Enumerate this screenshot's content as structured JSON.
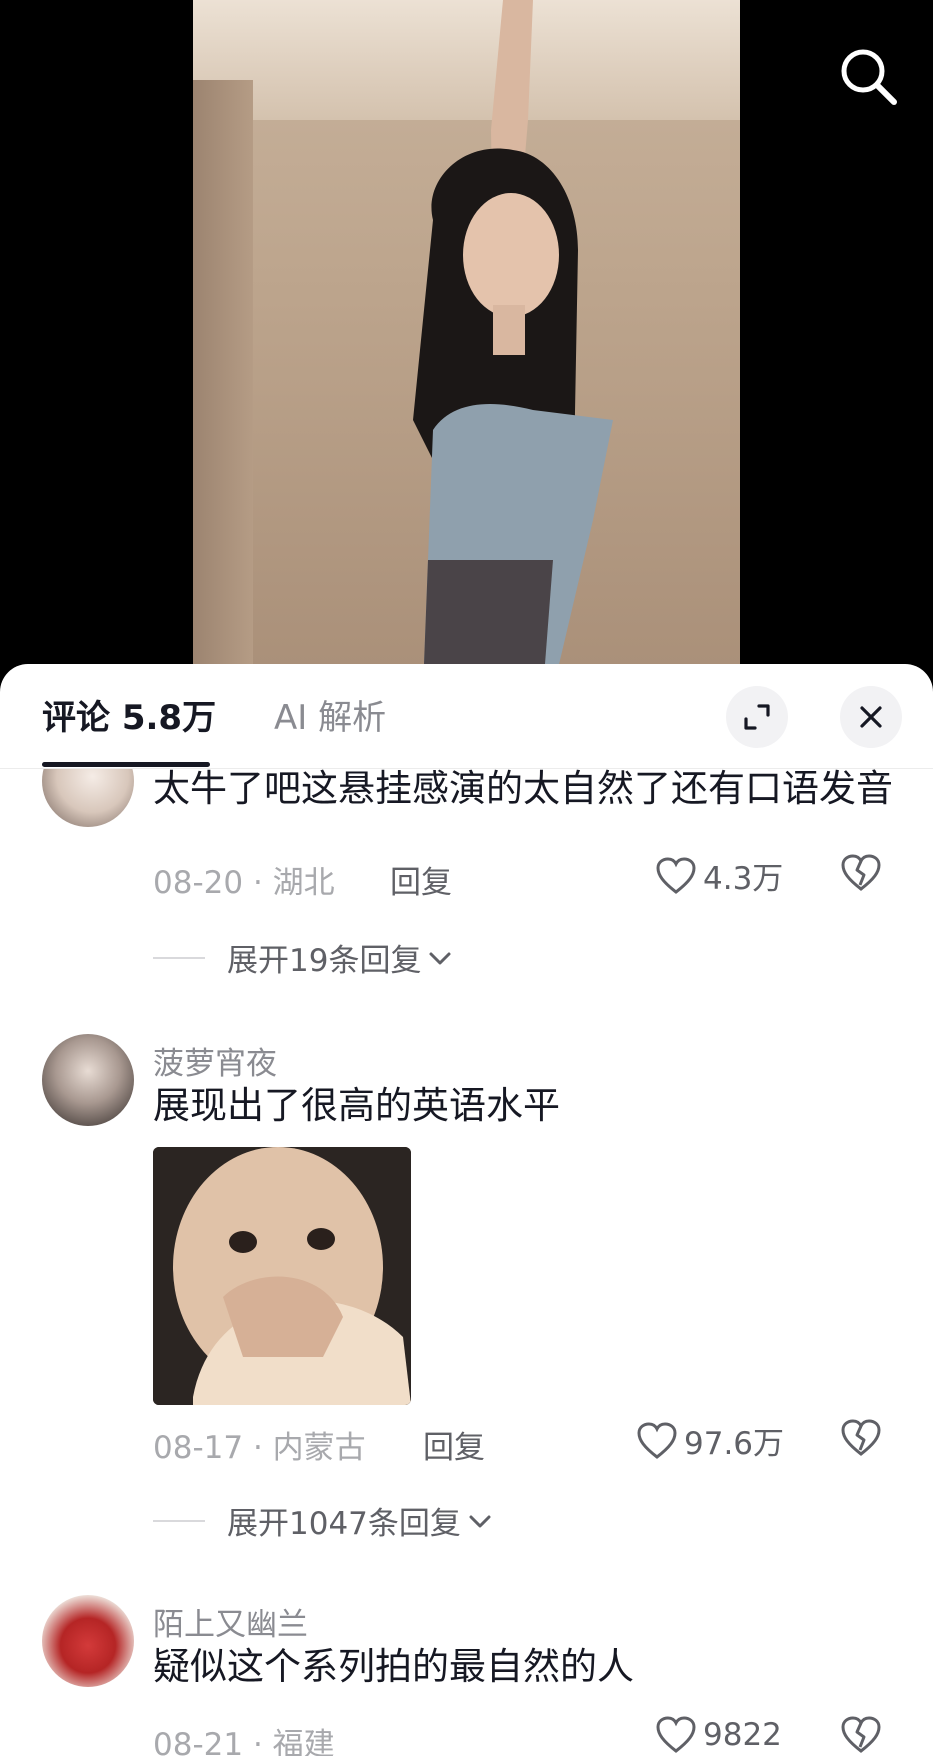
{
  "header": {
    "search_icon": "search-icon"
  },
  "tabs": [
    {
      "label": "评论 5.8万",
      "active": true
    },
    {
      "label": "AI 解析",
      "active": false
    }
  ],
  "toolbar": {
    "expand_icon": "expand-icon",
    "close_icon": "close-icon"
  },
  "comments": [
    {
      "text": "太牛了吧这悬挂感演的太自然了还有口语发音",
      "date": "08-20",
      "location": "湖北",
      "reply_label": "回复",
      "likes": "4.3万",
      "expand_replies": "展开19条回复"
    },
    {
      "username": "菠萝宵夜",
      "text": "展现出了很高的英语水平",
      "has_image": true,
      "date": "08-17",
      "location": "内蒙古",
      "reply_label": "回复",
      "likes": "97.6万",
      "expand_replies": "展开1047条回复"
    },
    {
      "username": "陌上又幽兰",
      "text": "疑似这个系列拍的最自然的人",
      "date": "08-21",
      "location": "福建",
      "likes": "9822"
    }
  ],
  "colors": {
    "primary_text": "#161823",
    "secondary_text": "#8a8b91",
    "sheet_bg": "#ffffff",
    "video_bg": "#000000"
  }
}
